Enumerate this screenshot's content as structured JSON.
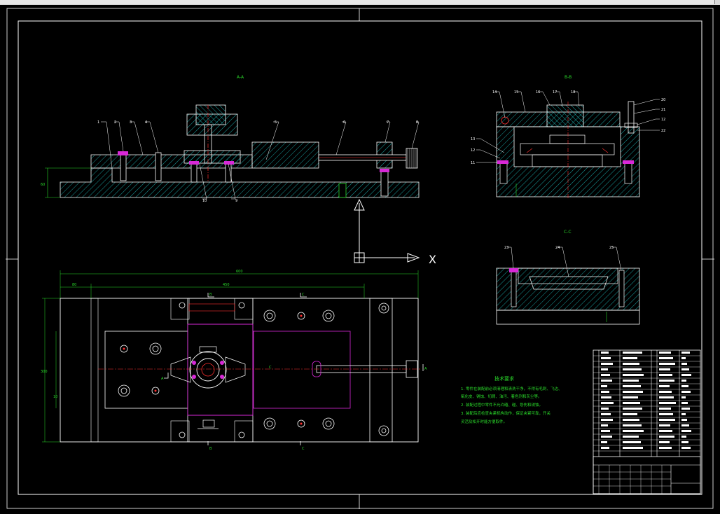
{
  "sections": {
    "aa": "A-A",
    "bb": "B-B",
    "cc": "C-C"
  },
  "section_markers": {
    "b1": "B",
    "b2": "B",
    "c1": "C",
    "c2": "C",
    "cl": "C",
    "a1": "A",
    "a2": "A"
  },
  "balloons_front": [
    "1",
    "2",
    "3",
    "4",
    "5",
    "6",
    "7",
    "8",
    "9",
    "10"
  ],
  "balloons_right": [
    "14",
    "15",
    "16",
    "17",
    "18",
    "20",
    "21",
    "12",
    "13",
    "12",
    "11",
    "22"
  ],
  "balloons_cc": [
    "23",
    "24",
    "25"
  ],
  "dimensions": {
    "front_height": "60",
    "plan_total": "600",
    "plan_left": "80",
    "plan_mid": "450",
    "plan_height": "300",
    "plan_sub": "10"
  },
  "ucs_label": "X",
  "tech": {
    "title": "技术要求",
    "lines": [
      "1. 零件在装配前必须清理和清洗干净，不得有毛刺、飞边、",
      "氧化皮、锈蚀、切屑、油污、着色剂和灰尘等。",
      "2. 装配过程中零件不允许磕、碰、划伤和锈蚀。",
      "3. 装配后应检查夹紧机构动作，保证夹紧可靠，开关",
      "灵活及松开时能方便取件。"
    ]
  },
  "colors": {
    "green": "#2bdc2b",
    "cyan": "#1ec8c8",
    "red": "#ff3030",
    "magenta": "#d828d8",
    "white": "#ffffff"
  }
}
